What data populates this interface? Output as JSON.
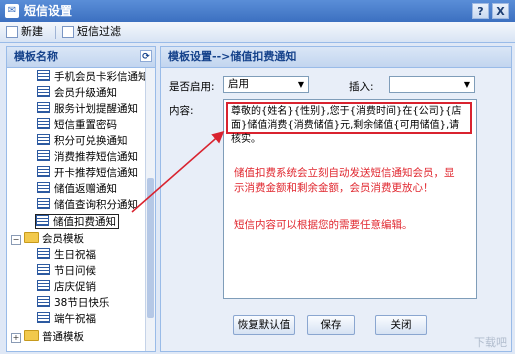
{
  "window": {
    "title": "短信设置",
    "help": "?",
    "close": "X"
  },
  "toolbar": {
    "new_label": "新建",
    "filter_label": "短信过滤"
  },
  "left_panel": {
    "header": "模板名称",
    "items": [
      "手机会员卡彩信通知",
      "会员升级通知",
      "服务计划提醒通知",
      "短信重置密码",
      "积分可兑换通知",
      "消费推荐短信通知",
      "开卡推荐短信通知",
      "储值返赠通知",
      "储值查询积分通知",
      "储值扣费通知",
      "会员模板",
      "生日祝福",
      "节日问候",
      "店庆促销",
      "38节日快乐",
      "端午祝福",
      "普通模板"
    ]
  },
  "right_panel": {
    "header": "模板设置-->储值扣费通知",
    "enabled_label": "是否启用:",
    "enabled_value": "启用",
    "insert_label": "插入:",
    "insert_value": "",
    "content_label": "内容:",
    "content_text": "尊敬的{姓名}{性别},您于{消费时间}在{公司}{店面}储值消费{消费储值}元,剩余储值{可用储值},请核实。",
    "note_line1": "储值扣费系统会立刻自动发送短信通知会员，显示消费金额和剩余金额，会员消费更放心！",
    "note_line2": "短信内容可以根据您的需要任意编辑。",
    "buttons": {
      "restore": "恢复默认值",
      "save": "保存",
      "close": "关闭"
    }
  },
  "watermark": "下载吧"
}
